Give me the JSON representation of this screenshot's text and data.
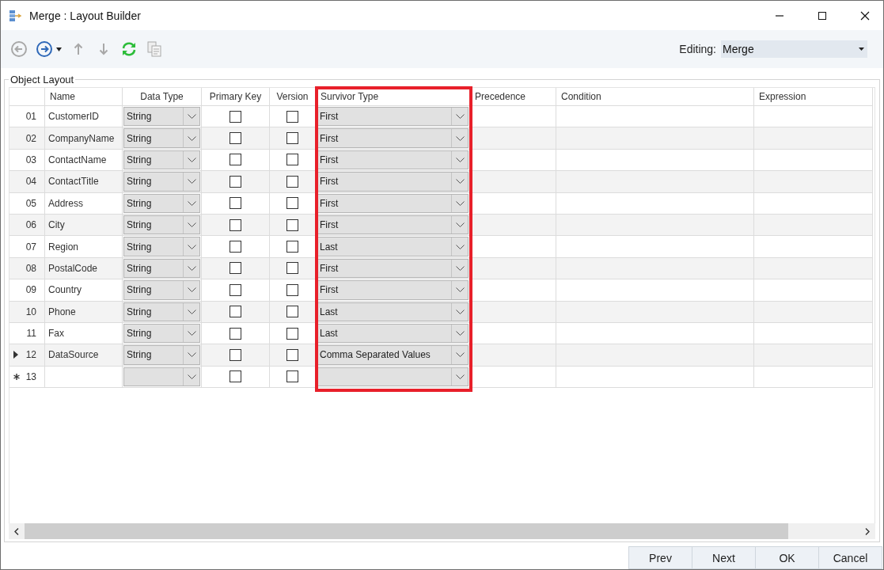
{
  "window": {
    "title": "Merge : Layout Builder"
  },
  "toolbar": {
    "buttons": [
      {
        "kind": "back",
        "disabled": true
      },
      {
        "kind": "forward",
        "disabled": false
      },
      {
        "kind": "up",
        "disabled": true
      },
      {
        "kind": "down",
        "disabled": true
      },
      {
        "kind": "refresh",
        "disabled": false
      },
      {
        "kind": "copy",
        "disabled": true
      }
    ],
    "editing": {
      "label": "Editing:",
      "value": "Merge"
    }
  },
  "group": {
    "title": "Object Layout"
  },
  "table": {
    "columns": [
      {
        "label": "Name"
      },
      {
        "label": "Data Type"
      },
      {
        "label": "Primary Key"
      },
      {
        "label": "Version"
      },
      {
        "label": "Survivor Type",
        "highlighted": true
      },
      {
        "label": "Precedence"
      },
      {
        "label": "Condition"
      },
      {
        "label": "Expression"
      }
    ],
    "rows": [
      {
        "number": "01",
        "current": false,
        "new_entry": false,
        "name": "CustomerID",
        "data_type": "String",
        "primary_key": false,
        "version": false,
        "survivor_type": "First"
      },
      {
        "number": "02",
        "current": false,
        "new_entry": false,
        "name": "CompanyName",
        "data_type": "String",
        "primary_key": false,
        "version": false,
        "survivor_type": "First"
      },
      {
        "number": "03",
        "current": false,
        "new_entry": false,
        "name": "ContactName",
        "data_type": "String",
        "primary_key": false,
        "version": false,
        "survivor_type": "First"
      },
      {
        "number": "04",
        "current": false,
        "new_entry": false,
        "name": "ContactTitle",
        "data_type": "String",
        "primary_key": false,
        "version": false,
        "survivor_type": "First"
      },
      {
        "number": "05",
        "current": false,
        "new_entry": false,
        "name": "Address",
        "data_type": "String",
        "primary_key": false,
        "version": false,
        "survivor_type": "First"
      },
      {
        "number": "06",
        "current": false,
        "new_entry": false,
        "name": "City",
        "data_type": "String",
        "primary_key": false,
        "version": false,
        "survivor_type": "First"
      },
      {
        "number": "07",
        "current": false,
        "new_entry": false,
        "name": "Region",
        "data_type": "String",
        "primary_key": false,
        "version": false,
        "survivor_type": "Last"
      },
      {
        "number": "08",
        "current": false,
        "new_entry": false,
        "name": "PostalCode",
        "data_type": "String",
        "primary_key": false,
        "version": false,
        "survivor_type": "First"
      },
      {
        "number": "09",
        "current": false,
        "new_entry": false,
        "name": "Country",
        "data_type": "String",
        "primary_key": false,
        "version": false,
        "survivor_type": "First"
      },
      {
        "number": "10",
        "current": false,
        "new_entry": false,
        "name": "Phone",
        "data_type": "String",
        "primary_key": false,
        "version": false,
        "survivor_type": "Last"
      },
      {
        "number": "11",
        "current": false,
        "new_entry": false,
        "name": "Fax",
        "data_type": "String",
        "primary_key": false,
        "version": false,
        "survivor_type": "Last"
      },
      {
        "number": "12",
        "current": true,
        "new_entry": false,
        "name": "DataSource",
        "data_type": "String",
        "primary_key": false,
        "version": false,
        "survivor_type": "Comma Separated Values"
      },
      {
        "number": "13",
        "current": false,
        "new_entry": true,
        "primary_key": false,
        "version": false
      }
    ]
  },
  "buttons": [
    {
      "label": "Prev"
    },
    {
      "label": "Next"
    },
    {
      "label": "OK"
    },
    {
      "label": "Cancel"
    }
  ]
}
